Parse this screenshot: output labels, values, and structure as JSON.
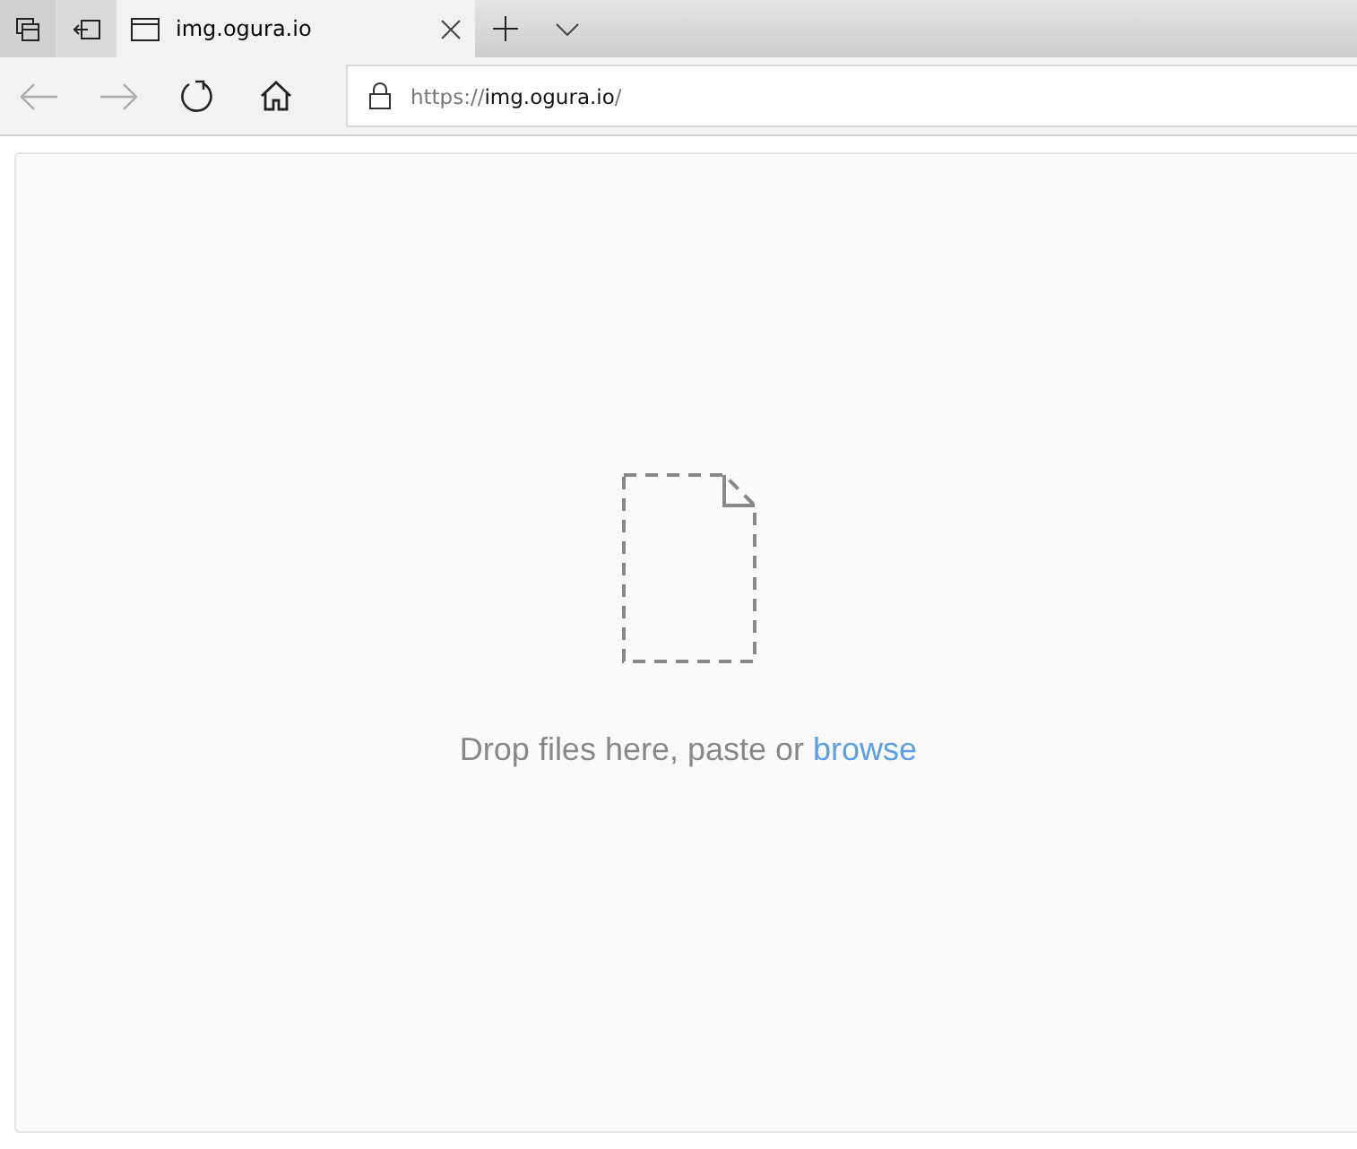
{
  "tabs": [
    {
      "title": "img.ogura.io",
      "selected": true
    }
  ],
  "address": {
    "scheme": "https://",
    "host": "img.ogura.io",
    "path": "/"
  },
  "drop_zone": {
    "message": "Drop files here, paste or ",
    "link": "browse"
  }
}
